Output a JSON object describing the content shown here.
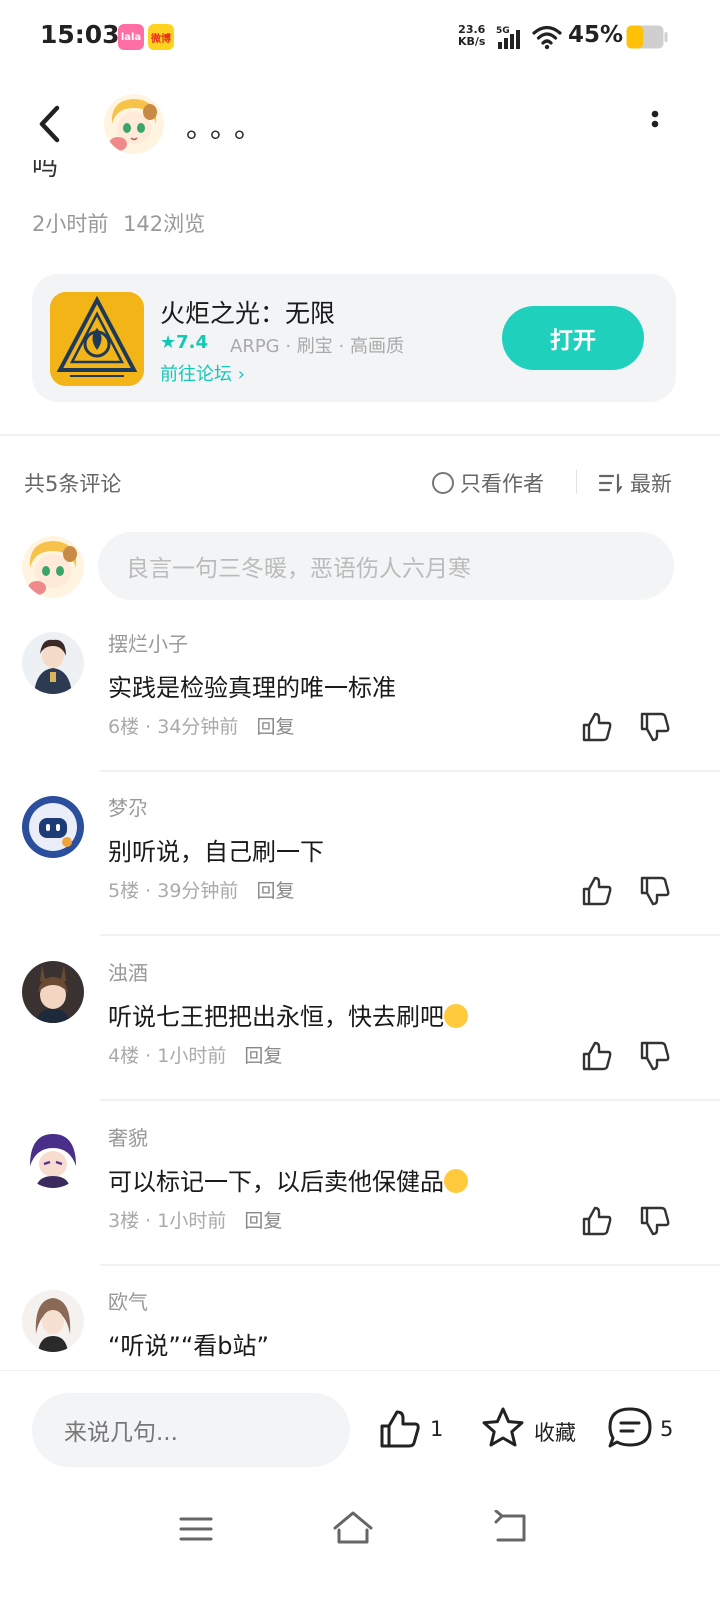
{
  "status_bar": {
    "time": "15:03",
    "app_badge_1": "lala",
    "app_badge_2": "微博",
    "net_speed_value": "23.6",
    "net_speed_unit": "KB/s",
    "network": "5G",
    "battery_percent": "45%",
    "battery_level": 0.45,
    "battery_color": "#ffc107"
  },
  "header": {
    "title": "。。。",
    "back_icon": "chevron-left-icon",
    "more_icon": "vertical-ellipsis-icon"
  },
  "post": {
    "cut_text": "吗",
    "time_ago": "2小时前",
    "views": "142浏览"
  },
  "game_card": {
    "name": "火炬之光：无限",
    "rating": "★7.4",
    "tags": "ARPG · 刷宝 · 高画质",
    "forum_link": "前往论坛",
    "open_label": "打开",
    "accent_color": "#1fd1bd"
  },
  "comments_header": {
    "count_label": "共5条评论",
    "author_only_label": "只看作者",
    "sort_label": "最新"
  },
  "comment_input": {
    "placeholder": "良言一句三冬暖，恶语伤人六月寒"
  },
  "comments": [
    {
      "user": "摆烂小子",
      "text": "实践是检验真理的唯一标准",
      "floor": "6楼",
      "time": "34分钟前",
      "reply": "回复"
    },
    {
      "user": "梦尕",
      "text": "别听说，自己刷一下",
      "floor": "5楼",
      "time": "39分钟前",
      "reply": "回复"
    },
    {
      "user": "浊酒",
      "text": "听说七王把把出永恒，快去刷吧",
      "floor": "4楼",
      "time": "1小时前",
      "reply": "回复"
    },
    {
      "user": "奢貌",
      "text": "可以标记一下，以后卖他保健品",
      "floor": "3楼",
      "time": "1小时前",
      "reply": "回复"
    },
    {
      "user": "欧气",
      "text": "“听说”“看b站”",
      "floor": "",
      "time": "",
      "reply": ""
    }
  ],
  "bottom_bar": {
    "input_placeholder": "来说几句...",
    "like_count": "1",
    "favorite_label": "收藏",
    "comment_count": "5"
  },
  "nav_bar": {
    "menu_icon": "menu-icon",
    "home_icon": "home-icon",
    "back_icon": "back-icon"
  }
}
